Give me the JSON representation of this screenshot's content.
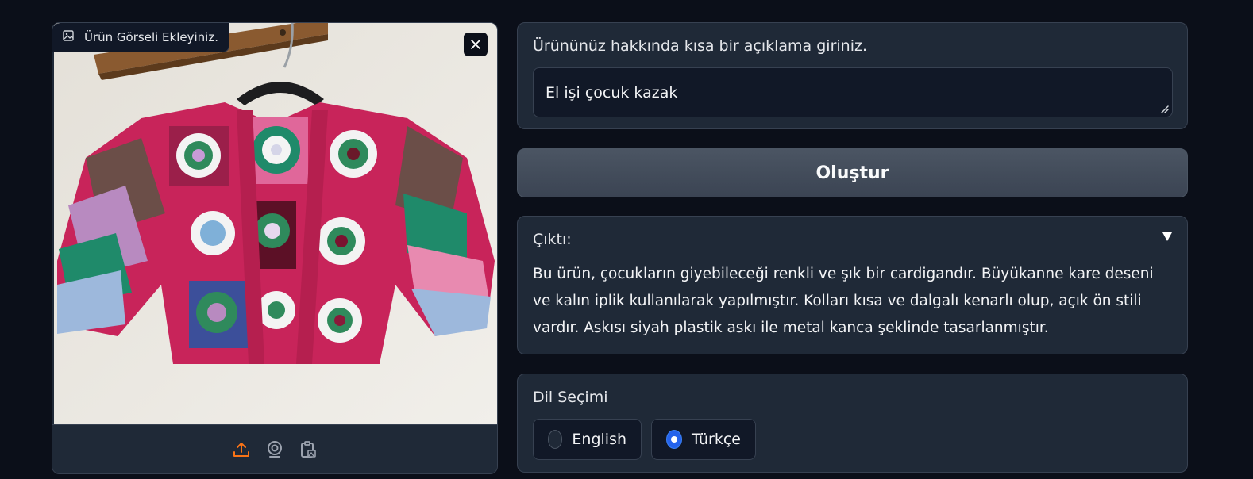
{
  "image_input": {
    "label": "Ürün Görseli Ekleyiniz.",
    "image_subject": "crochet granny-square children's cardigan on a hanger",
    "tools": [
      "upload-icon",
      "webcam-icon",
      "clipboard-icon"
    ],
    "accent_color": "#f97316"
  },
  "description": {
    "label": "Ürününüz hakkında kısa bir açıklama giriniz.",
    "value": "El işi çocuk kazak"
  },
  "generate": {
    "label": "Oluştur"
  },
  "output": {
    "label": "Çıktı:",
    "text": "Bu ürün, çocukların giyebileceği renkli ve şık bir cardigandır. Büyükanne kare deseni ve kalın iplik kullanılarak yapılmıştır. Kolları kısa ve dalgalı kenarlı olup, açık ön stili vardır. Askısı siyah plastik askı ile metal kanca şeklinde tasarlanmıştır."
  },
  "language": {
    "label": "Dil Seçimi",
    "options": [
      "English",
      "Türkçe"
    ],
    "selected": "Türkçe",
    "accent_color": "#2563eb"
  }
}
